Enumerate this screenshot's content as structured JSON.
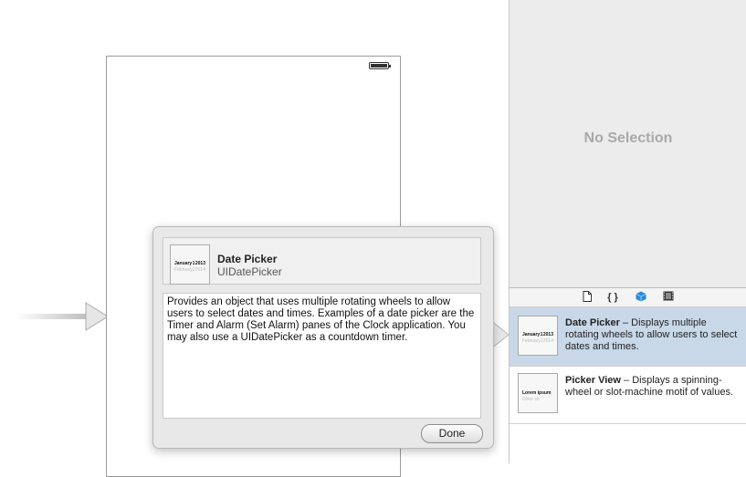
{
  "inspector": {
    "empty_message": "No Selection"
  },
  "library": {
    "tabs": [
      {
        "icon": "file-icon",
        "glyph": "🗋"
      },
      {
        "icon": "braces-icon",
        "glyph": "{ }"
      },
      {
        "icon": "cube-icon",
        "glyph": "⬢"
      },
      {
        "icon": "film-icon",
        "glyph": "▦"
      }
    ],
    "items": [
      {
        "name": "Date Picker",
        "separator": " – ",
        "description": "Displays multiple rotating wheels to allow users to select dates and times.",
        "selected": true
      },
      {
        "name": "Picker View",
        "separator": " – ",
        "description": "Displays a spinning-wheel or slot-machine motif of values.",
        "selected": false
      }
    ]
  },
  "popover": {
    "title": "Date Picker",
    "class_name": "UIDatePicker",
    "description": "Provides an object that uses multiple rotating wheels to allow users to select dates and times. Examples of a date picker are the Timer and Alarm (Set Alarm) panes of the Clock application. You may also use a UIDatePicker as a countdown timer.",
    "done_label": "Done"
  },
  "thumbnails": {
    "date_picker": {
      "month": "January",
      "day": "1",
      "year": "2013",
      "faded_month": "February",
      "faded_day": "2",
      "faded_year": "2014"
    },
    "picker_view": {
      "text": "Lorem ipsum",
      "faded": "Dolor sit"
    }
  },
  "colors": {
    "selection": "#c8d8e8",
    "panel_bg": "#ececec",
    "accent": "#2b8ad9"
  }
}
